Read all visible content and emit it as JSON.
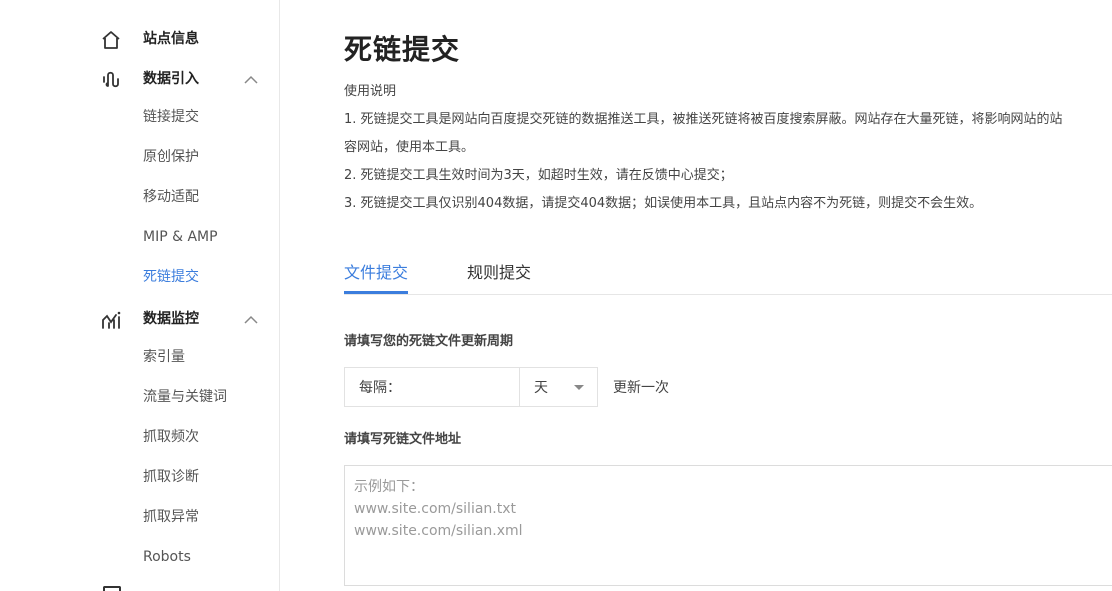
{
  "sidebar": {
    "site_info": {
      "label": "站点信息",
      "icon": "home-icon"
    },
    "data_import": {
      "label": "数据引入",
      "icon": "data-import-icon",
      "items": [
        "链接提交",
        "原创保护",
        "移动适配",
        "MIP & AMP",
        "死链提交"
      ],
      "active_index": 4
    },
    "data_monitor": {
      "label": "数据监控",
      "icon": "chart-icon",
      "items": [
        "索引量",
        "流量与关键词",
        "抓取频次",
        "抓取诊断",
        "抓取异常",
        "Robots"
      ]
    }
  },
  "main": {
    "title": "死链提交",
    "intro": {
      "heading": "使用说明",
      "line1": "1. 死链提交工具是网站向百度提交死链的数据推送工具，被推送死链将被百度搜索屏蔽。网站存在大量死链，将影响网站的站",
      "line1b": "容网站，使用本工具。",
      "line2": "2. 死链提交工具生效时间为3天，如超时生效，请在反馈中心提交；",
      "line3": "3. 死链提交工具仅识别404数据，请提交404数据；如误使用本工具，且站点内容不为死链，则提交不会生效。"
    },
    "tabs": [
      {
        "label": "文件提交",
        "active": true
      },
      {
        "label": "规则提交",
        "active": false
      }
    ],
    "form": {
      "period_label": "请填写您的死链文件更新周期",
      "period_prefix": "每隔：",
      "period_value": "",
      "period_unit": "天",
      "period_suffix": "更新一次",
      "address_label": "请填写死链文件地址",
      "address_placeholder": [
        "示例如下：",
        "www.site.com/silian.txt",
        "www.site.com/silian.xml"
      ]
    }
  },
  "colors": {
    "accent": "#3b7ddd",
    "text": "#333333",
    "border": "#e2e2e2"
  }
}
